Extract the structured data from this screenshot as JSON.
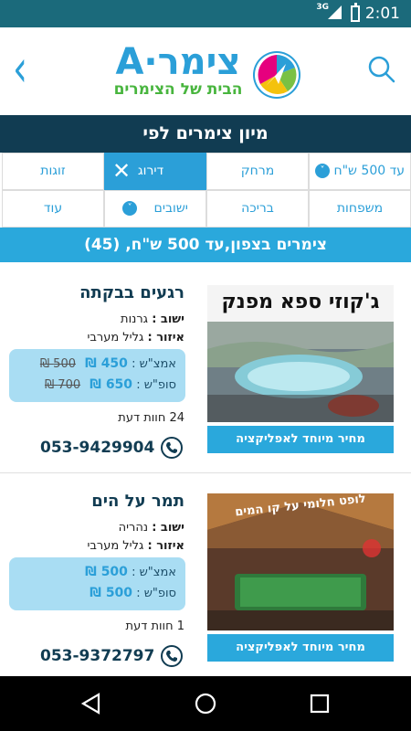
{
  "status_bar": {
    "network": "3G",
    "time": "2:01"
  },
  "header": {
    "logo_title": "צימר·A",
    "logo_subtitle": "הבית של הצימרים",
    "back_icon": "chevron-left-icon",
    "search_icon": "search-icon"
  },
  "sort": {
    "label": "מיון צימרים לפי"
  },
  "filters": {
    "row1": [
      "עד 500 ש\"ח",
      "מרחק",
      "דירוג",
      "זוגות"
    ],
    "row2": [
      "משפחות",
      "בריכה",
      "ישובים",
      "עוד"
    ]
  },
  "results": {
    "summary": "צימרים בצפון,עד 500 ש\"ח, (45)"
  },
  "listings": [
    {
      "title": "רגעים בבקתה",
      "settlement_label": "ישוב :",
      "settlement": "גרנות",
      "region_label": "איזור :",
      "region": "גליל מערבי",
      "midweek_label": "אמצ\"ש :",
      "midweek_price": "450 ₪",
      "midweek_old": "500 ₪",
      "weekend_label": "סופ\"ש :",
      "weekend_price": "650 ₪",
      "weekend_old": "700 ₪",
      "reviews": "24 חוות דעת",
      "phone": "053-9429904",
      "promo": "מחיר מיוחד לאפליקציה",
      "photo_caption": "ג'קוזי ספא מפנק"
    },
    {
      "title": "תמר על הים",
      "settlement_label": "ישוב :",
      "settlement": "נהריה",
      "region_label": "איזור :",
      "region": "גליל מערבי",
      "midweek_label": "אמצ\"ש :",
      "midweek_price": "500 ₪",
      "midweek_old": "",
      "weekend_label": "סופ\"ש :",
      "weekend_price": "500 ₪",
      "weekend_old": "",
      "reviews": "1 חוות דעת",
      "phone": "053-9372797",
      "promo": "מחיר מיוחד לאפליקציה",
      "photo_caption": "לופט חלומי על קו המים"
    }
  ],
  "colors": {
    "brand_blue": "#2b9fd8",
    "dark_navy": "#113c52",
    "price_bg": "#a9ddf3"
  }
}
